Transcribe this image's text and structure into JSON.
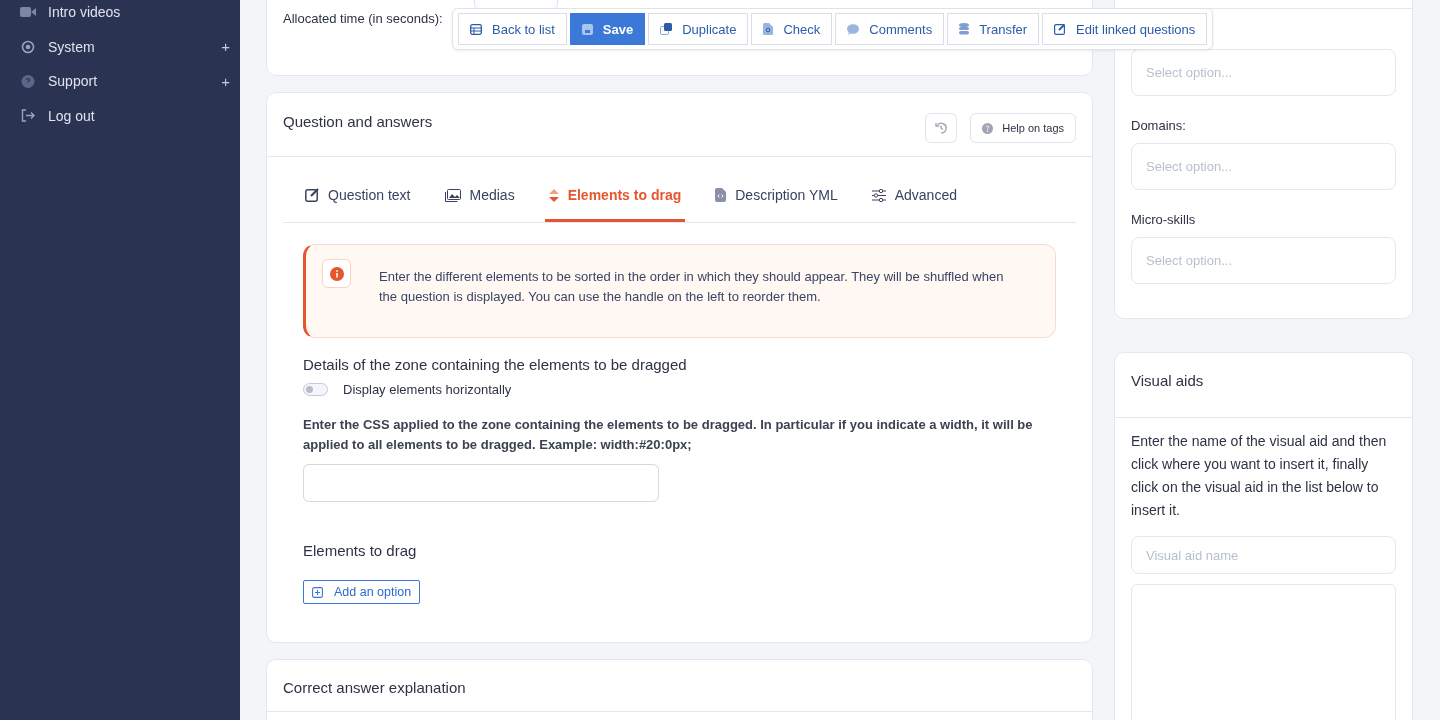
{
  "sidebar": {
    "items": [
      {
        "label": "Intro videos"
      },
      {
        "label": "System",
        "toggle": "+"
      },
      {
        "label": "Support",
        "toggle": "+"
      },
      {
        "label": "Log out"
      }
    ]
  },
  "general": {
    "allocated_time_label": "Allocated time (in seconds):"
  },
  "toolbar": {
    "buttons": [
      {
        "label": "Back to list",
        "primary": false
      },
      {
        "label": "Save",
        "primary": true
      },
      {
        "label": "Duplicate",
        "primary": false
      },
      {
        "label": "Check",
        "primary": false
      },
      {
        "label": "Comments",
        "primary": false
      },
      {
        "label": "Transfer",
        "primary": false
      },
      {
        "label": "Edit linked questions",
        "primary": false
      }
    ]
  },
  "question": {
    "title": "Question and answers",
    "help_button": "Help on tags",
    "tabs": [
      {
        "label": "Question text",
        "selected": false
      },
      {
        "label": "Medias",
        "selected": false
      },
      {
        "label": "Elements to drag",
        "selected": true
      },
      {
        "label": "Description YML",
        "selected": false
      },
      {
        "label": "Advanced",
        "selected": false
      }
    ],
    "alert": "Enter the different elements to be sorted in the order in which they should appear. They will be shuffled when the question is displayed. You can use the handle on the left to reorder them.",
    "zone_heading": "Details of the zone containing the elements to be dragged",
    "horizontal_toggle": {
      "label": "Display elements horizontally",
      "on": false
    },
    "css_help": "Enter the CSS applied to the zone containing the elements to be dragged. In particular if you indicate a width, it will be applied to all elements to be dragged. Example: width:#20:0px;",
    "elements_heading": "Elements to drag",
    "add_button": "Add an option"
  },
  "explanation": {
    "title": "Correct answer explanation"
  },
  "tags": {
    "fields": [
      {
        "placeholder": "Select option..."
      },
      {
        "label": "Domains:",
        "placeholder": "Select option..."
      },
      {
        "label": "Micro-skills",
        "placeholder": "Select option..."
      }
    ]
  },
  "visual_aids": {
    "title": "Visual aids",
    "text": "Enter the name of the visual aid and then click where you want to insert it, finally click on the visual aid in the list below to insert it.",
    "name_placeholder": "Visual aid name"
  }
}
